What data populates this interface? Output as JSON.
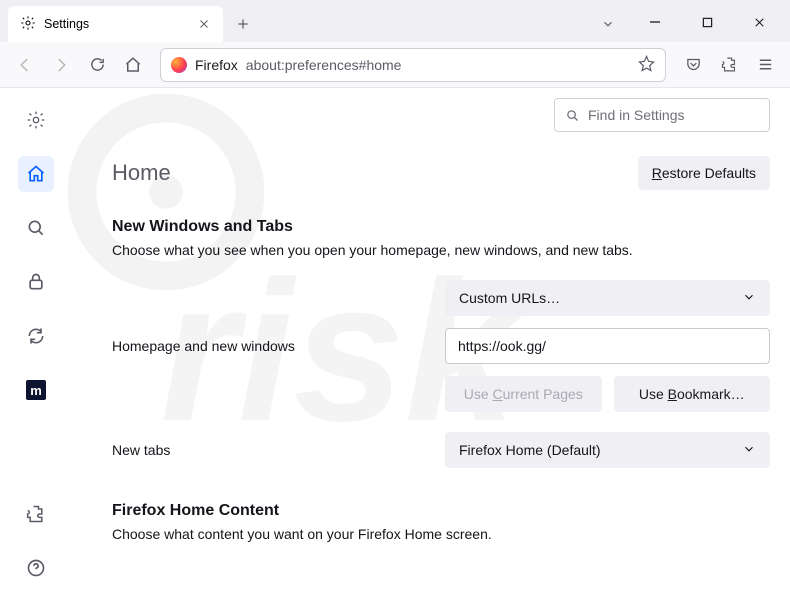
{
  "tab": {
    "title": "Settings"
  },
  "urlbar": {
    "context": "Firefox",
    "address": "about:preferences#home"
  },
  "search": {
    "placeholder": "Find in Settings"
  },
  "page": {
    "title": "Home",
    "restore": "Restore Defaults",
    "section1": {
      "heading": "New Windows and Tabs",
      "desc": "Choose what you see when you open your homepage, new windows, and new tabs.",
      "homepage_label": "Homepage and new windows",
      "homepage_dropdown": "Custom URLs…",
      "homepage_url": "https://ook.gg/",
      "use_current": "Use Current Pages",
      "use_bookmark": "Use Bookmark…",
      "newtabs_label": "New tabs",
      "newtabs_dropdown": "Firefox Home (Default)"
    },
    "section2": {
      "heading": "Firefox Home Content",
      "desc": "Choose what content you want on your Firefox Home screen."
    }
  },
  "sidebar": {
    "items": [
      "general",
      "home",
      "search",
      "privacy",
      "sync",
      "more",
      "extensions",
      "help"
    ]
  }
}
